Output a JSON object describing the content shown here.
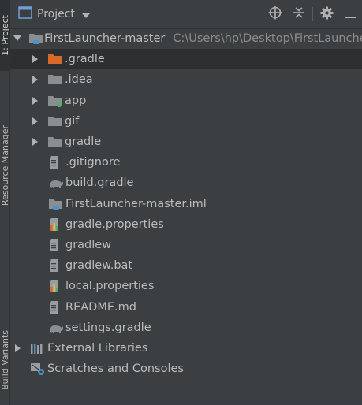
{
  "side_tabs": [
    {
      "label": "1: Project",
      "active": true
    },
    {
      "label": "Resource Manager",
      "active": false
    },
    {
      "label": "Build Variants",
      "active": false
    }
  ],
  "toolbar": {
    "title": "Project",
    "icons": [
      "crosshair-icon",
      "collapse-all-icon",
      "gear-icon",
      "minimize-icon"
    ]
  },
  "tree": {
    "root": {
      "label": "FirstLauncher-master",
      "path": "C:\\Users\\hp\\Desktop\\FirstLauncher"
    },
    "items": [
      {
        "label": ".gradle",
        "icon": "folder-orange-icon"
      },
      {
        "label": ".idea",
        "icon": "folder-icon"
      },
      {
        "label": "app",
        "icon": "module-folder-icon"
      },
      {
        "label": "gif",
        "icon": "folder-icon"
      },
      {
        "label": "gradle",
        "icon": "folder-icon"
      },
      {
        "label": ".gitignore",
        "icon": "text-file-icon"
      },
      {
        "label": "build.gradle",
        "icon": "gradle-elephant-icon"
      },
      {
        "label": "FirstLauncher-master.iml",
        "icon": "iml-file-icon"
      },
      {
        "label": "gradle.properties",
        "icon": "properties-file-icon"
      },
      {
        "label": "gradlew",
        "icon": "text-file-icon"
      },
      {
        "label": "gradlew.bat",
        "icon": "text-file-icon"
      },
      {
        "label": "local.properties",
        "icon": "properties-file-icon"
      },
      {
        "label": "README.md",
        "icon": "text-file-icon"
      },
      {
        "label": "settings.gradle",
        "icon": "gradle-elephant-icon"
      }
    ],
    "external_libraries": {
      "label": "External Libraries"
    },
    "scratches": {
      "label": "Scratches and Consoles"
    }
  },
  "colors": {
    "background": "#3C3F41",
    "selected_row": "#2D2F30",
    "text": "#BBBBBB",
    "path_text": "#8C8C8C",
    "folder": "#8A8E91",
    "gradle_folder": "#D9692B",
    "module_dot": "#59A869"
  }
}
